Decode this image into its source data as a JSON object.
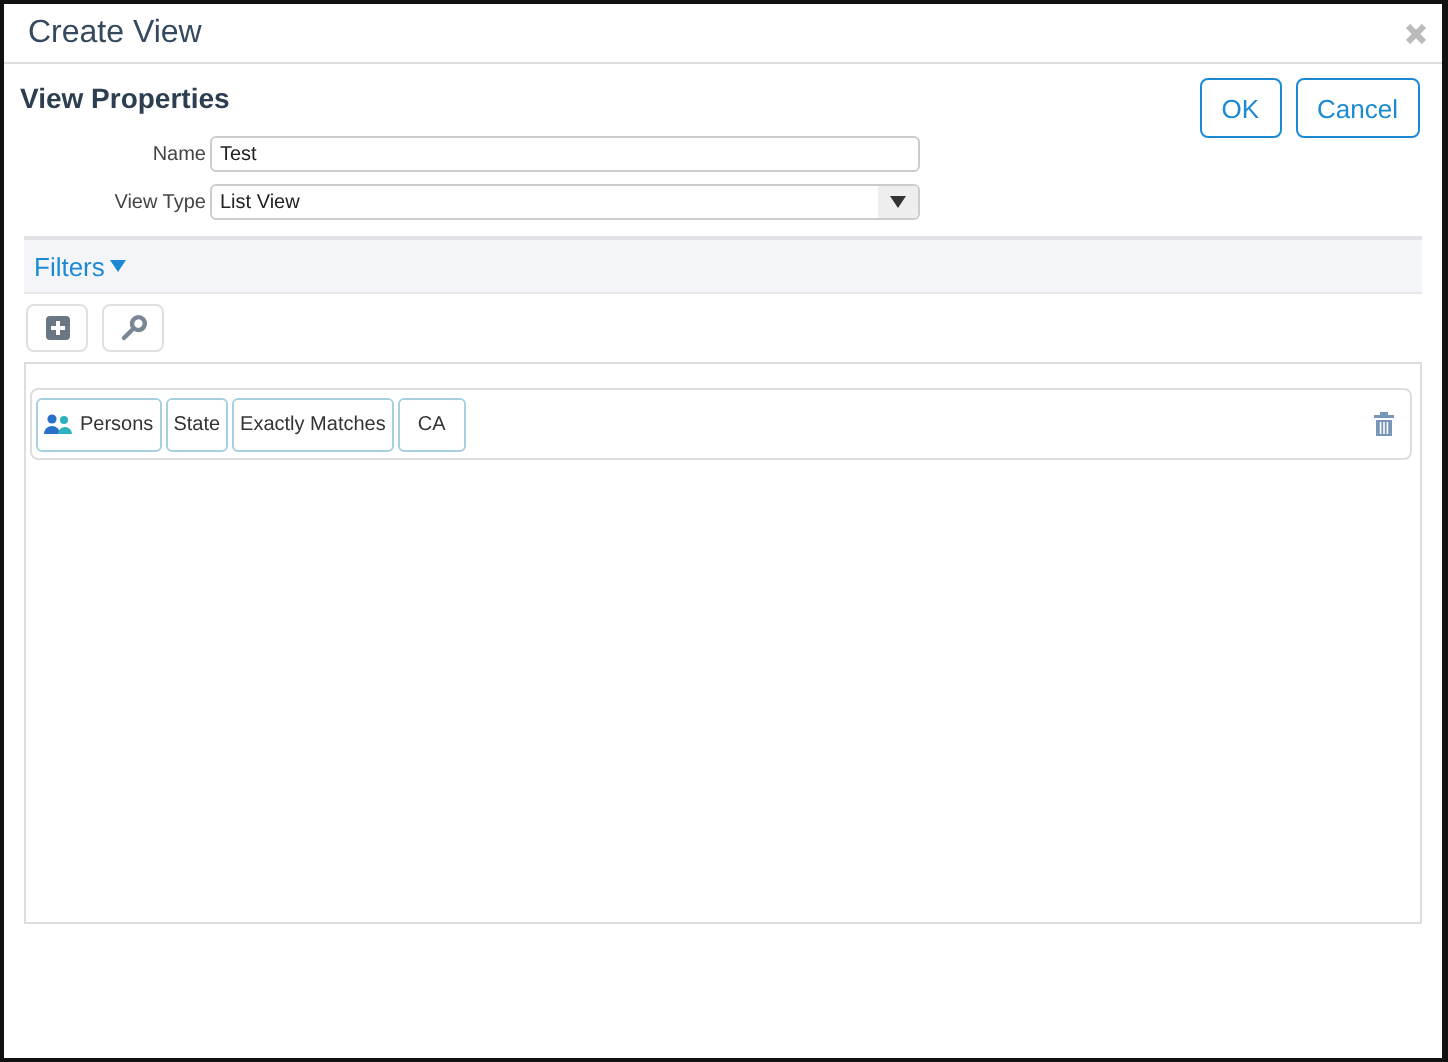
{
  "window": {
    "title": "Create View"
  },
  "section_title": "View Properties",
  "buttons": [
    {
      "label": "OK"
    },
    {
      "label": "Cancel"
    }
  ],
  "fields": [
    {
      "label": "Name",
      "kind": "text",
      "value": "Test"
    },
    {
      "label": "View Type",
      "kind": "select",
      "value": "List View"
    }
  ],
  "filters": {
    "title": "Filters",
    "expanded": true,
    "rows": [
      {
        "tokens": [
          {
            "kind": "entity",
            "text": "Persons"
          },
          {
            "kind": "plain",
            "text": "State"
          },
          {
            "kind": "plain",
            "text": "Exactly Matches"
          },
          {
            "kind": "value",
            "text": "CA"
          }
        ]
      }
    ]
  }
}
